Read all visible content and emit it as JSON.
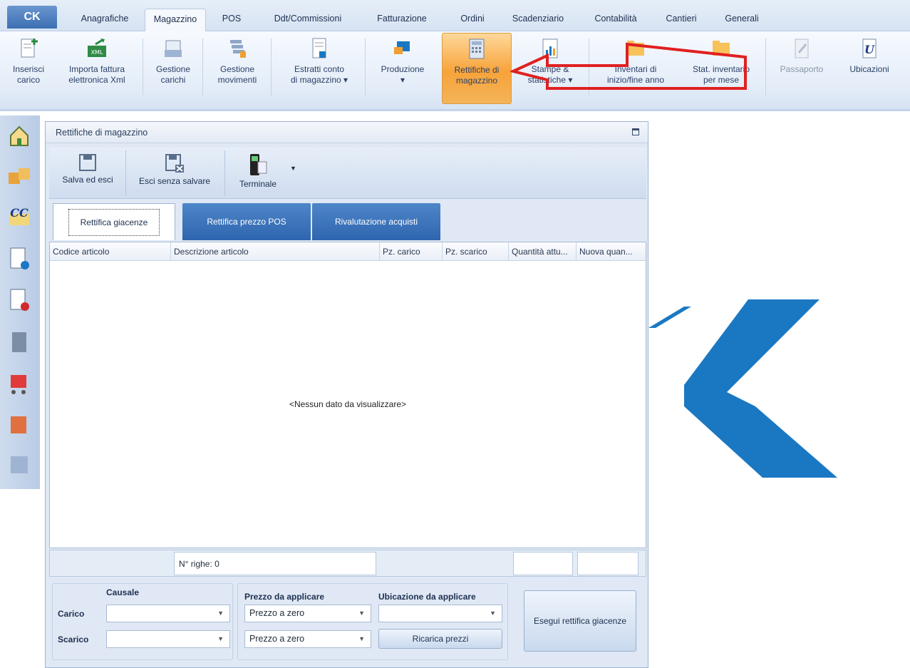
{
  "app": {
    "logo_text": "CK"
  },
  "ribbon_tabs": [
    "Anagrafiche",
    "Magazzino",
    "POS",
    "Ddt/Commissioni",
    "Fatturazione",
    "Ordini",
    "Scadenziario",
    "Contabilità",
    "Cantieri",
    "Generali"
  ],
  "ribbon_buttons": [
    {
      "l1": "Inserisci",
      "l2": "carico"
    },
    {
      "l1": "Importa fattura",
      "l2": "elettronica Xml"
    },
    {
      "l1": "Gestione",
      "l2": "carichi"
    },
    {
      "l1": "Gestione",
      "l2": "movimenti"
    },
    {
      "l1": "Estratti conto",
      "l2": "di magazzino ▾"
    },
    {
      "l1": "Produzione",
      "l2": "▾"
    },
    {
      "l1": "Rettifiche di",
      "l2": "magazzino"
    },
    {
      "l1": "Stampe &",
      "l2": "statistiche ▾"
    },
    {
      "l1": "Inventari di",
      "l2": "inizio/fine anno"
    },
    {
      "l1": "Stat. inventario",
      "l2": "per mese"
    },
    {
      "l1": "Passaporto",
      "l2": ""
    },
    {
      "l1": "Ubicazioni",
      "l2": ""
    }
  ],
  "window": {
    "title": "Rettifiche di magazzino",
    "toolbar": {
      "save": "Salva ed esci",
      "exit": "Esci senza salvare",
      "terminal": "Terminale"
    },
    "tabs": [
      "Rettifica giacenze",
      "Rettifica prezzo POS",
      "Rivalutazione acquisti"
    ],
    "columns": [
      "Codice articolo",
      "Descrizione articolo",
      "Pz. carico",
      "Pz. scarico",
      "Quantità attu...",
      "Nuova quan..."
    ],
    "empty_text": "<Nessun dato da visualizzare>",
    "row_count": "N° righe: 0",
    "form": {
      "causale": "Causale",
      "prezzo": "Prezzo da applicare",
      "ubicazione": "Ubicazione da applicare",
      "carico": "Carico",
      "scarico": "Scarico",
      "prezzo_carico": "Prezzo a zero",
      "prezzo_scarico": "Prezzo a zero",
      "ricarica": "Ricarica prezzi",
      "esegui": "Esegui rettifica giacenze"
    }
  },
  "colors": {
    "accent": "#1a78c2",
    "selected": "#f7a33a",
    "annotation": "#e02020"
  }
}
